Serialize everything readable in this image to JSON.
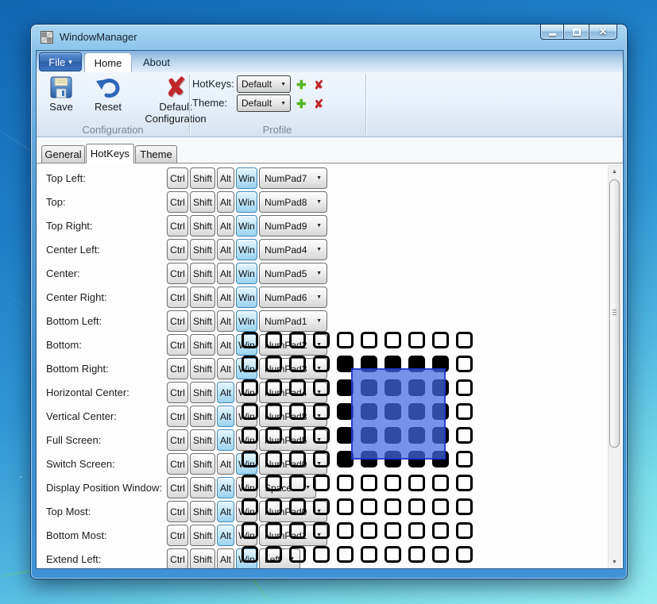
{
  "window": {
    "title": "WindowManager"
  },
  "ribbon": {
    "file_label": "File",
    "tabs": [
      {
        "label": "Home",
        "selected": true
      },
      {
        "label": "About",
        "selected": false
      }
    ],
    "groups": [
      {
        "label": "Configuration",
        "buttons": [
          {
            "label": "Save",
            "icon": "save-floppy-icon"
          },
          {
            "label": "Reset",
            "icon": "undo-arrow-icon"
          },
          {
            "label": "Default Configuration",
            "icon": "red-cross-icon"
          }
        ]
      },
      {
        "label": "Profile",
        "fields": [
          {
            "label": "HotKeys:",
            "value": "Default"
          },
          {
            "label": "Theme:",
            "value": "Default"
          }
        ]
      }
    ]
  },
  "tabs": [
    {
      "label": "General",
      "selected": false
    },
    {
      "label": "HotKeys",
      "selected": true
    },
    {
      "label": "Theme",
      "selected": false
    }
  ],
  "hotkeys": {
    "modifiers": [
      "Ctrl",
      "Shift",
      "Alt",
      "Win"
    ],
    "rows": [
      {
        "label": "Top Left:",
        "active": "Win",
        "key": "NumPad7"
      },
      {
        "label": "Top:",
        "active": "Win",
        "key": "NumPad8"
      },
      {
        "label": "Top Right:",
        "active": "Win",
        "key": "NumPad9"
      },
      {
        "label": "Center Left:",
        "active": "Win",
        "key": "NumPad4"
      },
      {
        "label": "Center:",
        "active": "Win",
        "key": "NumPad5"
      },
      {
        "label": "Center Right:",
        "active": "Win",
        "key": "NumPad6"
      },
      {
        "label": "Bottom Left:",
        "active": "Win",
        "key": "NumPad1"
      },
      {
        "label": "Bottom:",
        "active": "Win",
        "key": "NumPad2"
      },
      {
        "label": "Bottom Right:",
        "active": "Win",
        "key": "NumPad3"
      },
      {
        "label": "Horizontal Center:",
        "active": "Alt",
        "key": "NumPad4"
      },
      {
        "label": "Vertical Center:",
        "active": "Alt",
        "key": "NumPad8"
      },
      {
        "label": "Full Screen:",
        "active": "Alt",
        "key": "NumPad5"
      },
      {
        "label": "Switch Screen:",
        "active": "Win",
        "key": "NumPad0"
      },
      {
        "label": "Display Position Window:",
        "active": "Alt",
        "key": "Space"
      },
      {
        "label": "Top Most:",
        "active": "Alt",
        "key": "NumPad0"
      },
      {
        "label": "Bottom Most:",
        "active": "Alt",
        "key": "NumPad1"
      },
      {
        "label": "Extend Left:",
        "active": "Win",
        "key": "Left"
      }
    ]
  },
  "overlay_grid": {
    "rows": 10,
    "cols": 10,
    "filled": {
      "row_start": 1,
      "row_end": 5,
      "col_start": 4,
      "col_end": 8
    },
    "square_color": "#000000",
    "selection_color": "#4169e1"
  },
  "colors": {
    "active_modifier": "#9cd3ef",
    "aero_frame": "#3f90cf",
    "plus_green": "#54b426",
    "cross_red": "#c0272c"
  },
  "icons": {
    "close_glyph": "✕",
    "caret_glyph": "▾",
    "dropdown_glyph": "▼",
    "plus_glyph": "✚",
    "cross_glyph": "✘",
    "scroll_up_glyph": "▲",
    "scroll_down_glyph": "▼"
  }
}
